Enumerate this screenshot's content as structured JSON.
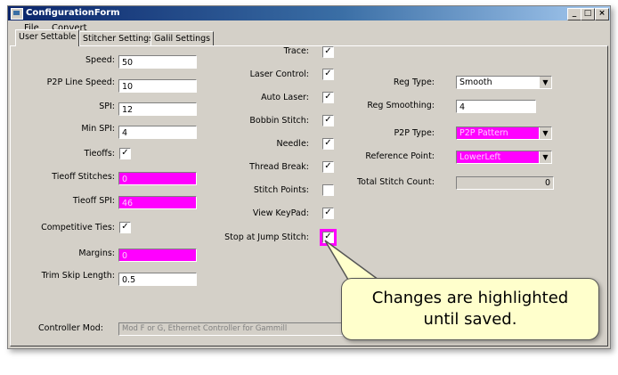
{
  "window": {
    "title": "ConfigurationForm",
    "minimize": "_",
    "maximize": "□",
    "close": "×"
  },
  "menu": {
    "file": "File",
    "convert": "Convert"
  },
  "tabs": [
    "User Settable",
    "Stitcher Settings",
    "Galil Settings"
  ],
  "left": {
    "speed": {
      "label": "Speed:",
      "value": "50"
    },
    "p2p_line_speed": {
      "label": "P2P Line Speed:",
      "value": "10"
    },
    "spi": {
      "label": "SPI:",
      "value": "12"
    },
    "min_spi": {
      "label": "Min SPI:",
      "value": "4"
    },
    "tieoffs": {
      "label": "Tieoffs:",
      "checked": "✓"
    },
    "tieoff_stitches": {
      "label": "Tieoff Stitches:",
      "value": "0"
    },
    "tieoff_spi": {
      "label": "Tieoff SPI:",
      "value": "46"
    },
    "competitive_ties": {
      "label": "Competitive Ties:",
      "checked": "✓"
    },
    "margins": {
      "label": "Margins:",
      "value": "0"
    },
    "trim_skip_length": {
      "label": "Trim Skip Length:",
      "value": "0.5"
    }
  },
  "middle": [
    {
      "label": "Trace:",
      "checked": "✓"
    },
    {
      "label": "Laser Control:",
      "checked": "✓"
    },
    {
      "label": "Auto Laser:",
      "checked": "✓"
    },
    {
      "label": "Bobbin Stitch:",
      "checked": "✓"
    },
    {
      "label": "Needle:",
      "checked": "✓"
    },
    {
      "label": "Thread Break:",
      "checked": "✓"
    },
    {
      "label": "Stitch Points:",
      "checked": ""
    },
    {
      "label": "View KeyPad:",
      "checked": "✓"
    },
    {
      "label": "Stop at Jump Stitch:",
      "checked": "✓"
    }
  ],
  "right": {
    "reg_type": {
      "label": "Reg Type:",
      "value": "Smooth"
    },
    "reg_smoothing": {
      "label": "Reg Smoothing:",
      "value": "4"
    },
    "p2p_type": {
      "label": "P2P Type:",
      "value": "P2P Pattern"
    },
    "reference_point": {
      "label": "Reference Point:",
      "value": "LowerLeft"
    },
    "total_stitch_count": {
      "label": "Total Stitch Count:",
      "value": "0"
    }
  },
  "controller": {
    "label": "Controller Mod:",
    "value": "Mod F or G, Ethernet Controller for Gammill"
  },
  "callout": {
    "line1": "Changes are highlighted",
    "line2": "until saved."
  },
  "colors": {
    "highlight": "#ff00ff",
    "titlebar": "#0a246a"
  }
}
